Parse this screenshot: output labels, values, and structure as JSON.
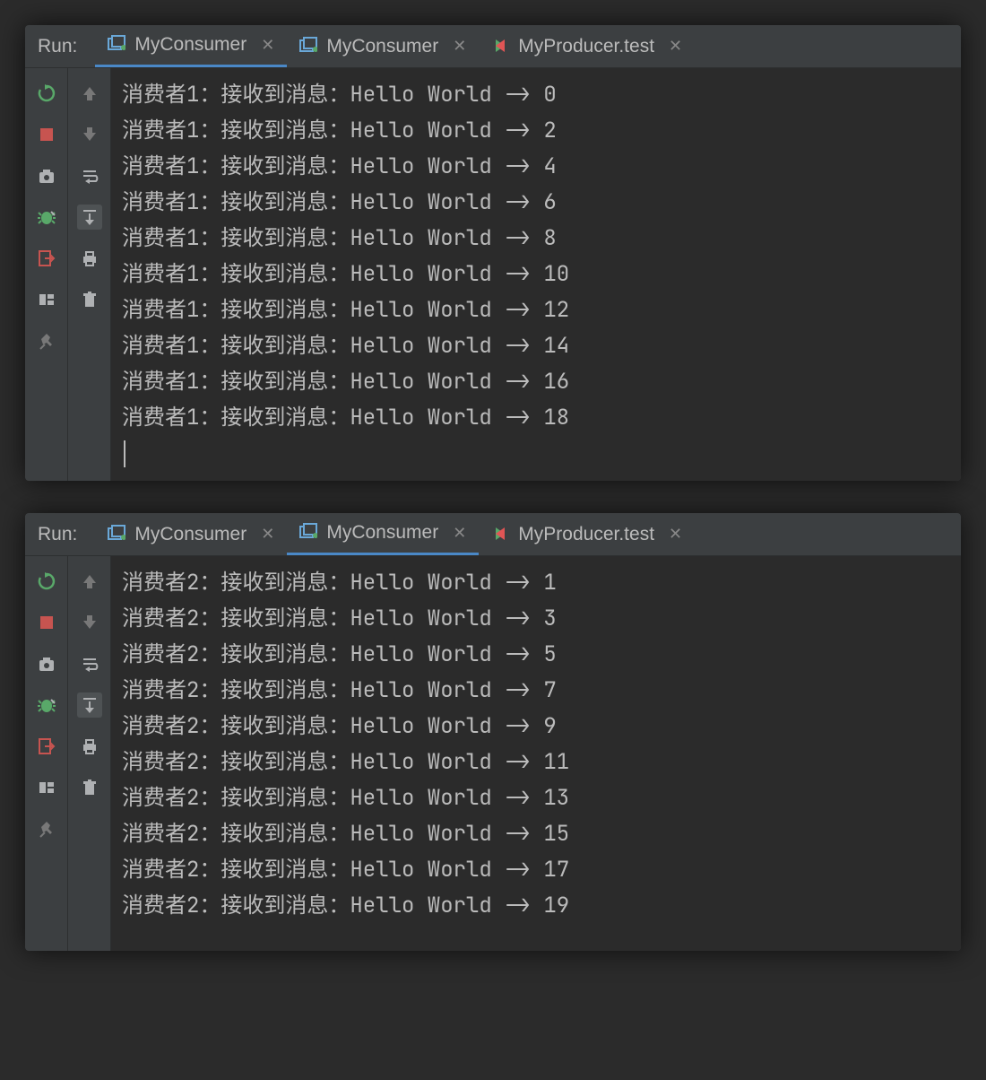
{
  "run_label": "Run:",
  "panels": [
    {
      "active_tab_index": 0,
      "tabs": [
        {
          "label": "MyConsumer",
          "icon": "app-icon",
          "closeable": true
        },
        {
          "label": "MyConsumer",
          "icon": "app-icon",
          "closeable": true
        },
        {
          "label": "MyProducer.test",
          "icon": "test-icon",
          "closeable": true
        }
      ],
      "lines": [
        "消费者1：接收到消息：Hello World -> 0",
        "消费者1：接收到消息：Hello World -> 2",
        "消费者1：接收到消息：Hello World -> 4",
        "消费者1：接收到消息：Hello World -> 6",
        "消费者1：接收到消息：Hello World -> 8",
        "消费者1：接收到消息：Hello World -> 10",
        "消费者1：接收到消息：Hello World -> 12",
        "消费者1：接收到消息：Hello World -> 14",
        "消费者1：接收到消息：Hello World -> 16",
        "消费者1：接收到消息：Hello World -> 18"
      ],
      "show_cursor": true
    },
    {
      "active_tab_index": 1,
      "tabs": [
        {
          "label": "MyConsumer",
          "icon": "app-icon",
          "closeable": true
        },
        {
          "label": "MyConsumer",
          "icon": "app-icon",
          "closeable": true
        },
        {
          "label": "MyProducer.test",
          "icon": "test-icon",
          "closeable": true
        }
      ],
      "lines": [
        "消费者2：接收到消息：Hello World -> 1",
        "消费者2：接收到消息：Hello World -> 3",
        "消费者2：接收到消息：Hello World -> 5",
        "消费者2：接收到消息：Hello World -> 7",
        "消费者2：接收到消息：Hello World -> 9",
        "消费者2：接收到消息：Hello World -> 11",
        "消费者2：接收到消息：Hello World -> 13",
        "消费者2：接收到消息：Hello World -> 15",
        "消费者2：接收到消息：Hello World -> 17",
        "消费者2：接收到消息：Hello World -> 19"
      ],
      "show_cursor": false
    }
  ],
  "toolbar_left": [
    {
      "name": "rerun-icon",
      "title": "Rerun"
    },
    {
      "name": "stop-icon",
      "title": "Stop"
    },
    {
      "name": "snapshot-icon",
      "title": "Dump Threads"
    },
    {
      "name": "debug-config-icon",
      "title": "Run with Profiler"
    },
    {
      "name": "exit-icon",
      "title": "Exit"
    },
    {
      "name": "layout-icon",
      "title": "Layout"
    },
    {
      "name": "pin-icon",
      "title": "Pin"
    }
  ],
  "toolbar_inner": [
    {
      "name": "up-icon",
      "title": "Up"
    },
    {
      "name": "down-icon",
      "title": "Down"
    },
    {
      "name": "wrap-icon",
      "title": "Soft-Wrap"
    },
    {
      "name": "scroll-end-icon",
      "title": "Scroll to End",
      "active": true
    },
    {
      "name": "print-icon",
      "title": "Print"
    },
    {
      "name": "trash-icon",
      "title": "Clear"
    }
  ]
}
